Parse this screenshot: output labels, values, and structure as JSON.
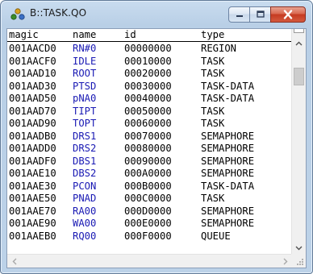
{
  "window": {
    "title": "B::TASK.QO"
  },
  "table": {
    "columns": [
      "magic",
      "name",
      "id",
      "type"
    ],
    "rows": [
      [
        "001AACD0",
        "RN#0",
        "00000000",
        "REGION"
      ],
      [
        "001AACF0",
        "IDLE",
        "00010000",
        "TASK"
      ],
      [
        "001AAD10",
        "ROOT",
        "00020000",
        "TASK"
      ],
      [
        "001AAD30",
        "PTSD",
        "00030000",
        "TASK-DATA"
      ],
      [
        "001AAD50",
        "pNA0",
        "00040000",
        "TASK-DATA"
      ],
      [
        "001AAD70",
        "TIPT",
        "00050000",
        "TASK"
      ],
      [
        "001AAD90",
        "TOPT",
        "00060000",
        "TASK"
      ],
      [
        "001AADB0",
        "DRS1",
        "00070000",
        "SEMAPHORE"
      ],
      [
        "001AADD0",
        "DRS2",
        "00080000",
        "SEMAPHORE"
      ],
      [
        "001AADF0",
        "DBS1",
        "00090000",
        "SEMAPHORE"
      ],
      [
        "001AAE10",
        "DBS2",
        "000A0000",
        "SEMAPHORE"
      ],
      [
        "001AAE30",
        "PCON",
        "000B0000",
        "TASK-DATA"
      ],
      [
        "001AAE50",
        "PNAD",
        "000C0000",
        "TASK"
      ],
      [
        "001AAE70",
        "RA00",
        "000D0000",
        "SEMAPHORE"
      ],
      [
        "001AAE90",
        "WA00",
        "000E0000",
        "SEMAPHORE"
      ],
      [
        "001AAEB0",
        "RQ00",
        "000F0000",
        "QUEUE"
      ]
    ]
  },
  "colors": {
    "name_column": "#1a1ab4",
    "close_button": "#c53a21"
  },
  "icons": {
    "app": "trace32-task-icon",
    "minimize": "minimize-icon",
    "maximize": "maximize-icon",
    "close": "close-icon",
    "scroll_up": "chevron-up-icon",
    "scroll_down": "chevron-down-icon",
    "scroll_left": "chevron-left-icon",
    "scroll_right": "chevron-right-icon",
    "resize": "resize-grip-icon"
  }
}
